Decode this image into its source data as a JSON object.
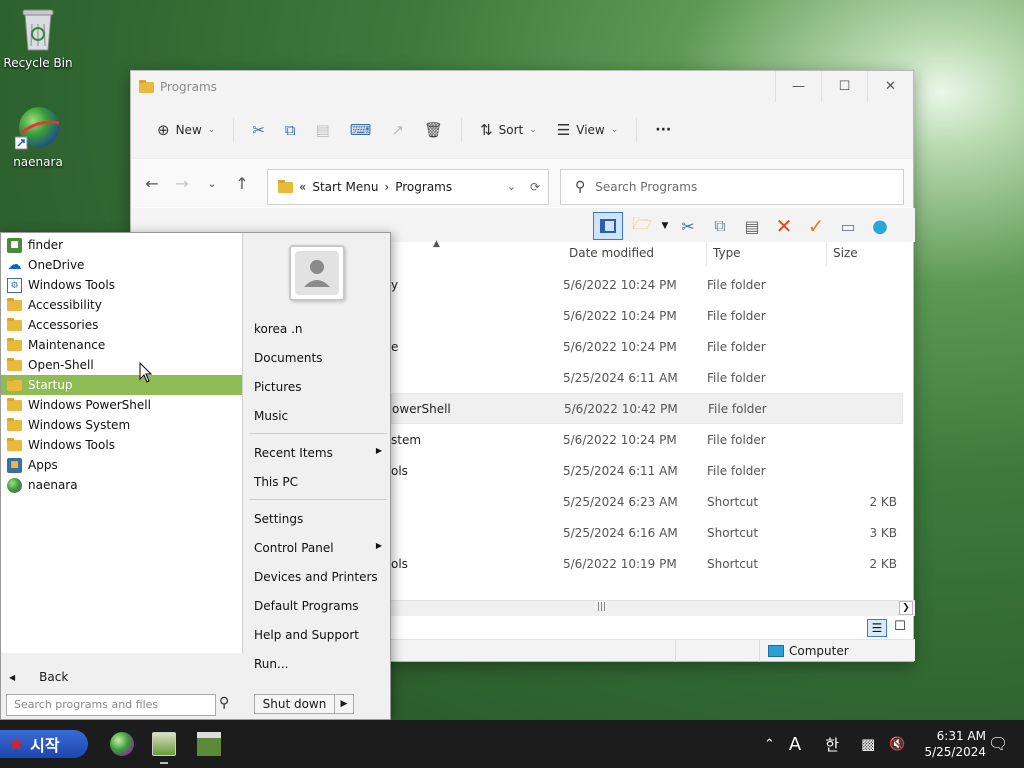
{
  "desktop": {
    "icons": [
      {
        "label": "Recycle Bin"
      },
      {
        "label": "naenara"
      }
    ]
  },
  "explorer": {
    "title": "Programs",
    "toolbar": {
      "new_label": "New",
      "sort_label": "Sort",
      "view_label": "View",
      "more_label": "···"
    },
    "address": {
      "chevron": "«",
      "parts": [
        "Start Menu",
        "Programs"
      ],
      "separator": "›"
    },
    "search_placeholder": "Search Programs",
    "columns": {
      "date": "Date modified",
      "type": "Type",
      "size": "Size"
    },
    "rows": [
      {
        "name_tail": "y",
        "date": "5/6/2022 10:24 PM",
        "type": "File folder",
        "size": ""
      },
      {
        "name_tail": "",
        "date": "5/6/2022 10:24 PM",
        "type": "File folder",
        "size": ""
      },
      {
        "name_tail": "e",
        "date": "5/6/2022 10:24 PM",
        "type": "File folder",
        "size": ""
      },
      {
        "name_tail": "",
        "date": "5/25/2024 6:11 AM",
        "type": "File folder",
        "size": ""
      },
      {
        "name_tail": "owerShell",
        "date": "5/6/2022 10:42 PM",
        "type": "File folder",
        "size": ""
      },
      {
        "name_tail": "stem",
        "date": "5/6/2022 10:24 PM",
        "type": "File folder",
        "size": ""
      },
      {
        "name_tail": "ols",
        "date": "5/25/2024 6:11 AM",
        "type": "File folder",
        "size": ""
      },
      {
        "name_tail": "",
        "date": "5/25/2024 6:23 AM",
        "type": "Shortcut",
        "size": "2 KB"
      },
      {
        "name_tail": "",
        "date": "5/25/2024 6:16 AM",
        "type": "Shortcut",
        "size": "3 KB"
      },
      {
        "name_tail": "ols",
        "date": "5/6/2022 10:19 PM",
        "type": "Shortcut",
        "size": "2 KB"
      }
    ],
    "status_computer": "Computer"
  },
  "startmenu": {
    "programs": [
      {
        "label": "finder",
        "icon": "finder-icon"
      },
      {
        "label": "OneDrive",
        "icon": "onedrive-icon"
      },
      {
        "label": "Windows Tools",
        "icon": "windows-tools-icon"
      },
      {
        "label": "Accessibility",
        "icon": "folder-icon"
      },
      {
        "label": "Accessories",
        "icon": "folder-icon"
      },
      {
        "label": "Maintenance",
        "icon": "folder-icon"
      },
      {
        "label": "Open-Shell",
        "icon": "folder-icon"
      },
      {
        "label": "Startup",
        "icon": "folder-icon"
      },
      {
        "label": "Windows PowerShell",
        "icon": "folder-icon"
      },
      {
        "label": "Windows System",
        "icon": "folder-icon"
      },
      {
        "label": "Windows Tools",
        "icon": "folder-icon"
      },
      {
        "label": "Apps",
        "icon": "apps-icon"
      },
      {
        "label": "naenara",
        "icon": "naenara-icon"
      }
    ],
    "back_label": "Back",
    "search_placeholder": "Search programs and files",
    "right": {
      "user": "korea .n",
      "documents": "Documents",
      "pictures": "Pictures",
      "music": "Music",
      "recent": "Recent Items",
      "this_pc": "This PC",
      "settings": "Settings",
      "control_panel": "Control Panel",
      "devices": "Devices and Printers",
      "default_programs": "Default Programs",
      "help": "Help and Support",
      "run": "Run...",
      "shutdown": "Shut down"
    }
  },
  "taskbar": {
    "start_label": "시작",
    "ime_mode": "A",
    "ime_lang": "한",
    "time": "6:31 AM",
    "date": "5/25/2024"
  },
  "colors": {
    "selection": "#8ebc54",
    "taskbar": "#1c1c1c",
    "start_button": "#2a57c4"
  }
}
